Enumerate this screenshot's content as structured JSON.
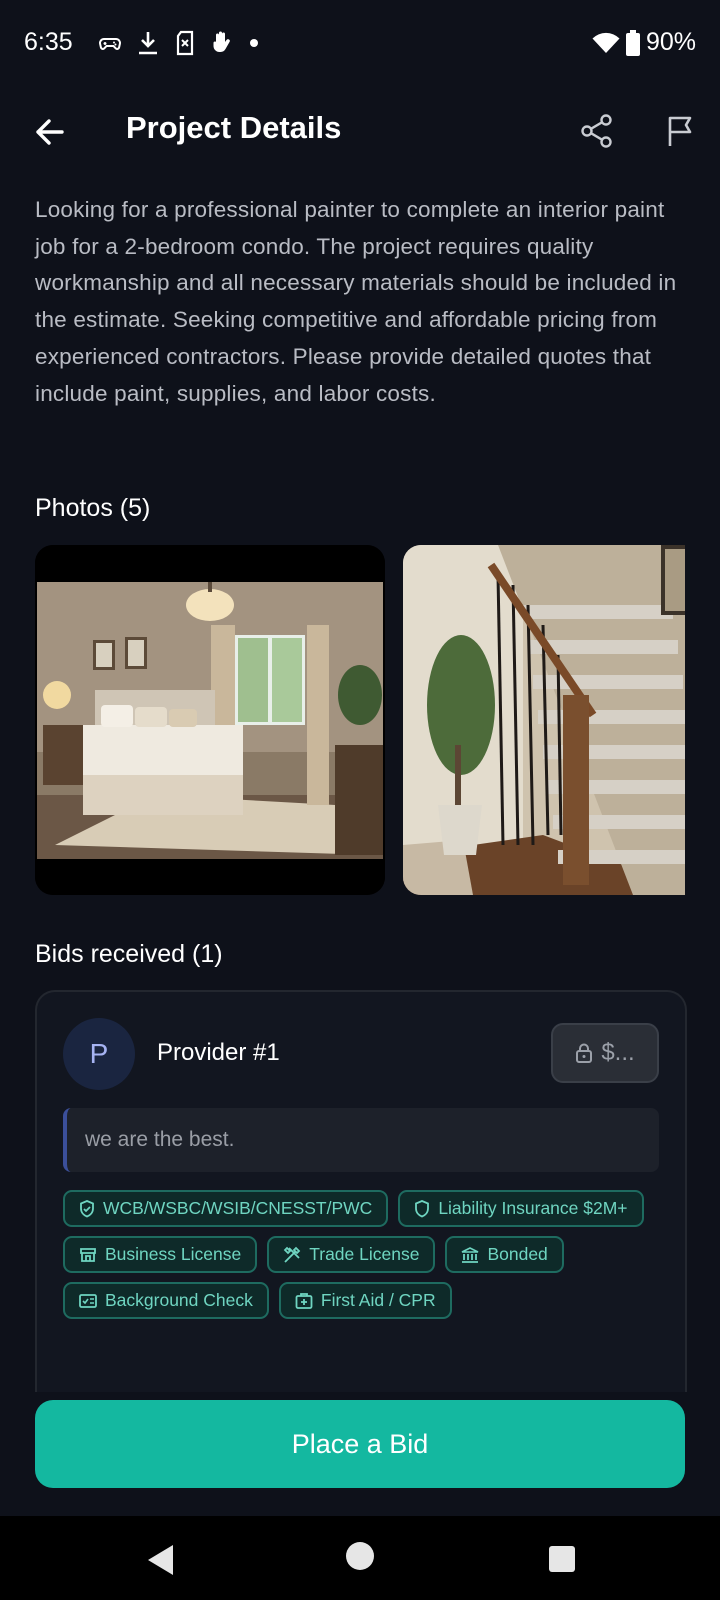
{
  "status_bar": {
    "time": "6:35",
    "battery": "90%"
  },
  "header": {
    "title": "Project Details"
  },
  "description": "Looking for a professional painter to complete an interior paint job for a 2-bedroom condo. The project requires quality workmanship and all necessary materials should be included in the estimate. Seeking competitive and affordable pricing from experienced contractors. Please provide detailed quotes that include paint, supplies, and labor costs.",
  "photos": {
    "title": "Photos (5)"
  },
  "bids": {
    "title": "Bids received (1)",
    "items": [
      {
        "avatar_letter": "P",
        "provider": "Provider #1",
        "price_masked": "$...",
        "message": "we are the best.",
        "tags": [
          {
            "label": "WCB/WSBC/WSIB/CNESST/PWC",
            "icon": "shield-check-icon"
          },
          {
            "label": "Liability Insurance $2M+",
            "icon": "shield-icon"
          },
          {
            "label": "Business License",
            "icon": "store-icon"
          },
          {
            "label": "Trade License",
            "icon": "tools-icon"
          },
          {
            "label": "Bonded",
            "icon": "bank-icon"
          },
          {
            "label": "Background Check",
            "icon": "id-card-icon"
          },
          {
            "label": "First Aid / CPR",
            "icon": "first-aid-icon"
          }
        ]
      }
    ]
  },
  "action": {
    "place_bid": "Place a Bid"
  },
  "colors": {
    "background": "#0e111a",
    "accent": "#14b8a0",
    "tag_text": "#6fd5c1",
    "avatar_bg": "#1a2540"
  }
}
